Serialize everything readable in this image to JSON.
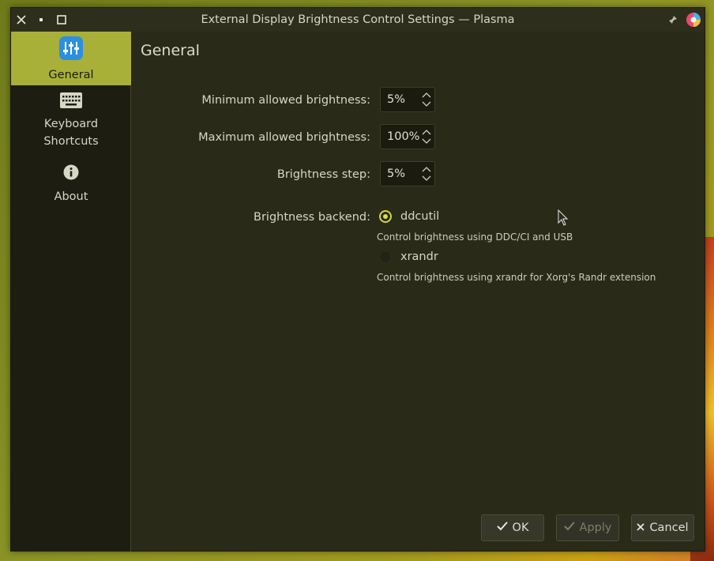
{
  "window": {
    "title": "External Display Brightness Control Settings — Plasma"
  },
  "titlebar_buttons": {
    "close_icon": "close-icon",
    "minimize_icon": "minimize-icon",
    "maximize_icon": "maximize-icon",
    "pin_icon": "pin-icon",
    "app_icon": "app-icon"
  },
  "sidebar": {
    "items": [
      {
        "label": "General",
        "icon": "sliders-icon",
        "active": true
      },
      {
        "label_line1": "Keyboard",
        "label_line2": "Shortcuts",
        "icon": "keyboard-icon",
        "active": false
      },
      {
        "label": "About",
        "icon": "info-icon",
        "active": false
      }
    ]
  },
  "page": {
    "title": "General"
  },
  "form": {
    "min_brightness": {
      "label": "Minimum allowed brightness:",
      "value": "5%"
    },
    "max_brightness": {
      "label": "Maximum allowed brightness:",
      "value": "100%"
    },
    "step": {
      "label": "Brightness step:",
      "value": "5%"
    },
    "backend": {
      "label": "Brightness backend:",
      "options": [
        {
          "label": "ddcutil",
          "description": "Control brightness using DDC/CI and USB",
          "selected": true
        },
        {
          "label": "xrandr",
          "description": "Control brightness using xrandr for Xorg's Randr extension",
          "selected": false
        }
      ]
    }
  },
  "buttons": {
    "ok": "OK",
    "apply": "Apply",
    "cancel": "Cancel"
  },
  "colors": {
    "accent": "#a8b03a",
    "window_bg": "#2a2a18",
    "sidebar_bg": "#1d1d12"
  }
}
